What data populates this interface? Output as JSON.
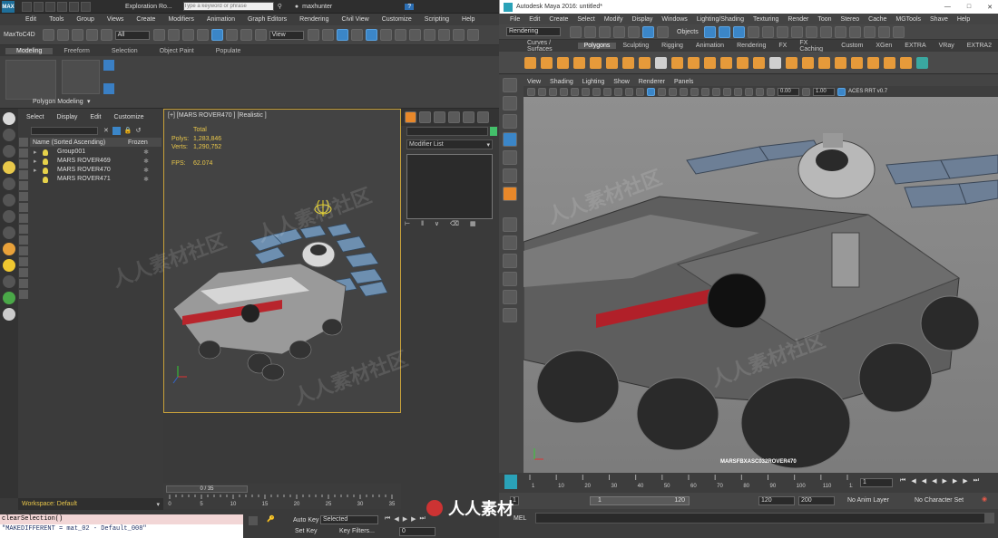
{
  "max": {
    "title": "Exploration Ro...",
    "search_placeholder": "Type a keyword or phrase",
    "user": "maxhunter",
    "logo": "MAX",
    "menu": [
      "Edit",
      "Tools",
      "Group",
      "Views",
      "Create",
      "Modifiers",
      "Animation",
      "Graph Editors",
      "Rendering",
      "Civil View",
      "Customize",
      "Scripting",
      "Help"
    ],
    "toolbar_label": "MaxToC4D",
    "selection_filter": "All",
    "ref_coord": "View",
    "ribbon_tabs": [
      "Modeling",
      "Freeform",
      "Selection",
      "Object Paint",
      "Populate"
    ],
    "ribbon_panel": "Polygon Modeling",
    "explorer_menu": [
      "Select",
      "Display",
      "Edit",
      "Customize"
    ],
    "explorer_header": {
      "name": "Name (Sorted Ascending)",
      "frozen": "Frozen"
    },
    "explorer_rows": [
      "Group001",
      "MARS ROVER469",
      "MARS ROVER470",
      "MARS ROVER471"
    ],
    "viewport_label": "[+] [MARS ROVER470 ] [Realistic ]",
    "stats": {
      "total": "Total",
      "polys_label": "Polys:",
      "polys": "1,283,846",
      "verts_label": "Verts:",
      "verts": "1,290,752",
      "fps_label": "FPS:",
      "fps": "62.074"
    },
    "modifier_list": "Modifier List",
    "time_slider": "0 / 35",
    "ticks": [
      "0",
      "5",
      "10",
      "15",
      "20",
      "25",
      "30",
      "35"
    ],
    "workspace": "Workspace: Default",
    "script_lines": [
      "clearSelection()",
      "\"MAKEDIFFERENT = mat_02 - Default_008\""
    ],
    "auto_key": "Auto Key",
    "set_key": "Set Key",
    "selected": "Selected",
    "key_filters": "Key Filters...",
    "frame": "0"
  },
  "maya": {
    "title": "Autodesk Maya 2016: untitled*",
    "menu": [
      "File",
      "Edit",
      "Create",
      "Select",
      "Modify",
      "Display",
      "Windows",
      "Lighting/Shading",
      "Texturing",
      "Render",
      "Toon",
      "Stereo",
      "Cache",
      "MGTools",
      "Shave",
      "Help"
    ],
    "mode": "Rendering",
    "objects_label": "Objects",
    "shelf_tabs": [
      "Curves / Surfaces",
      "Polygons",
      "Sculpting",
      "Rigging",
      "Animation",
      "Rendering",
      "FX",
      "FX Caching",
      "Custom",
      "XGen",
      "EXTRA",
      "VRay",
      "EXTRA2"
    ],
    "active_shelf": "Polygons",
    "viewport_menu": [
      "View",
      "Shading",
      "Lighting",
      "Show",
      "Renderer",
      "Panels"
    ],
    "values": [
      "0.00",
      "1.00"
    ],
    "colorspace": "ACES RRT v0.7",
    "object_label": "MARSFBXASC032ROVER470",
    "timeline_ticks": [
      "1",
      "10",
      "20",
      "30",
      "40",
      "50",
      "60",
      "70",
      "80",
      "90",
      "100",
      "110",
      "120"
    ],
    "current_frame": "1",
    "range": {
      "start": "1",
      "start2": "1",
      "range_end": "120",
      "end": "120",
      "end2": "200"
    },
    "anim_layer": "No Anim Layer",
    "character_set": "No Character Set",
    "mel_label": "MEL"
  },
  "watermark": "人人素材社区",
  "overlay_brand": "人人素材"
}
